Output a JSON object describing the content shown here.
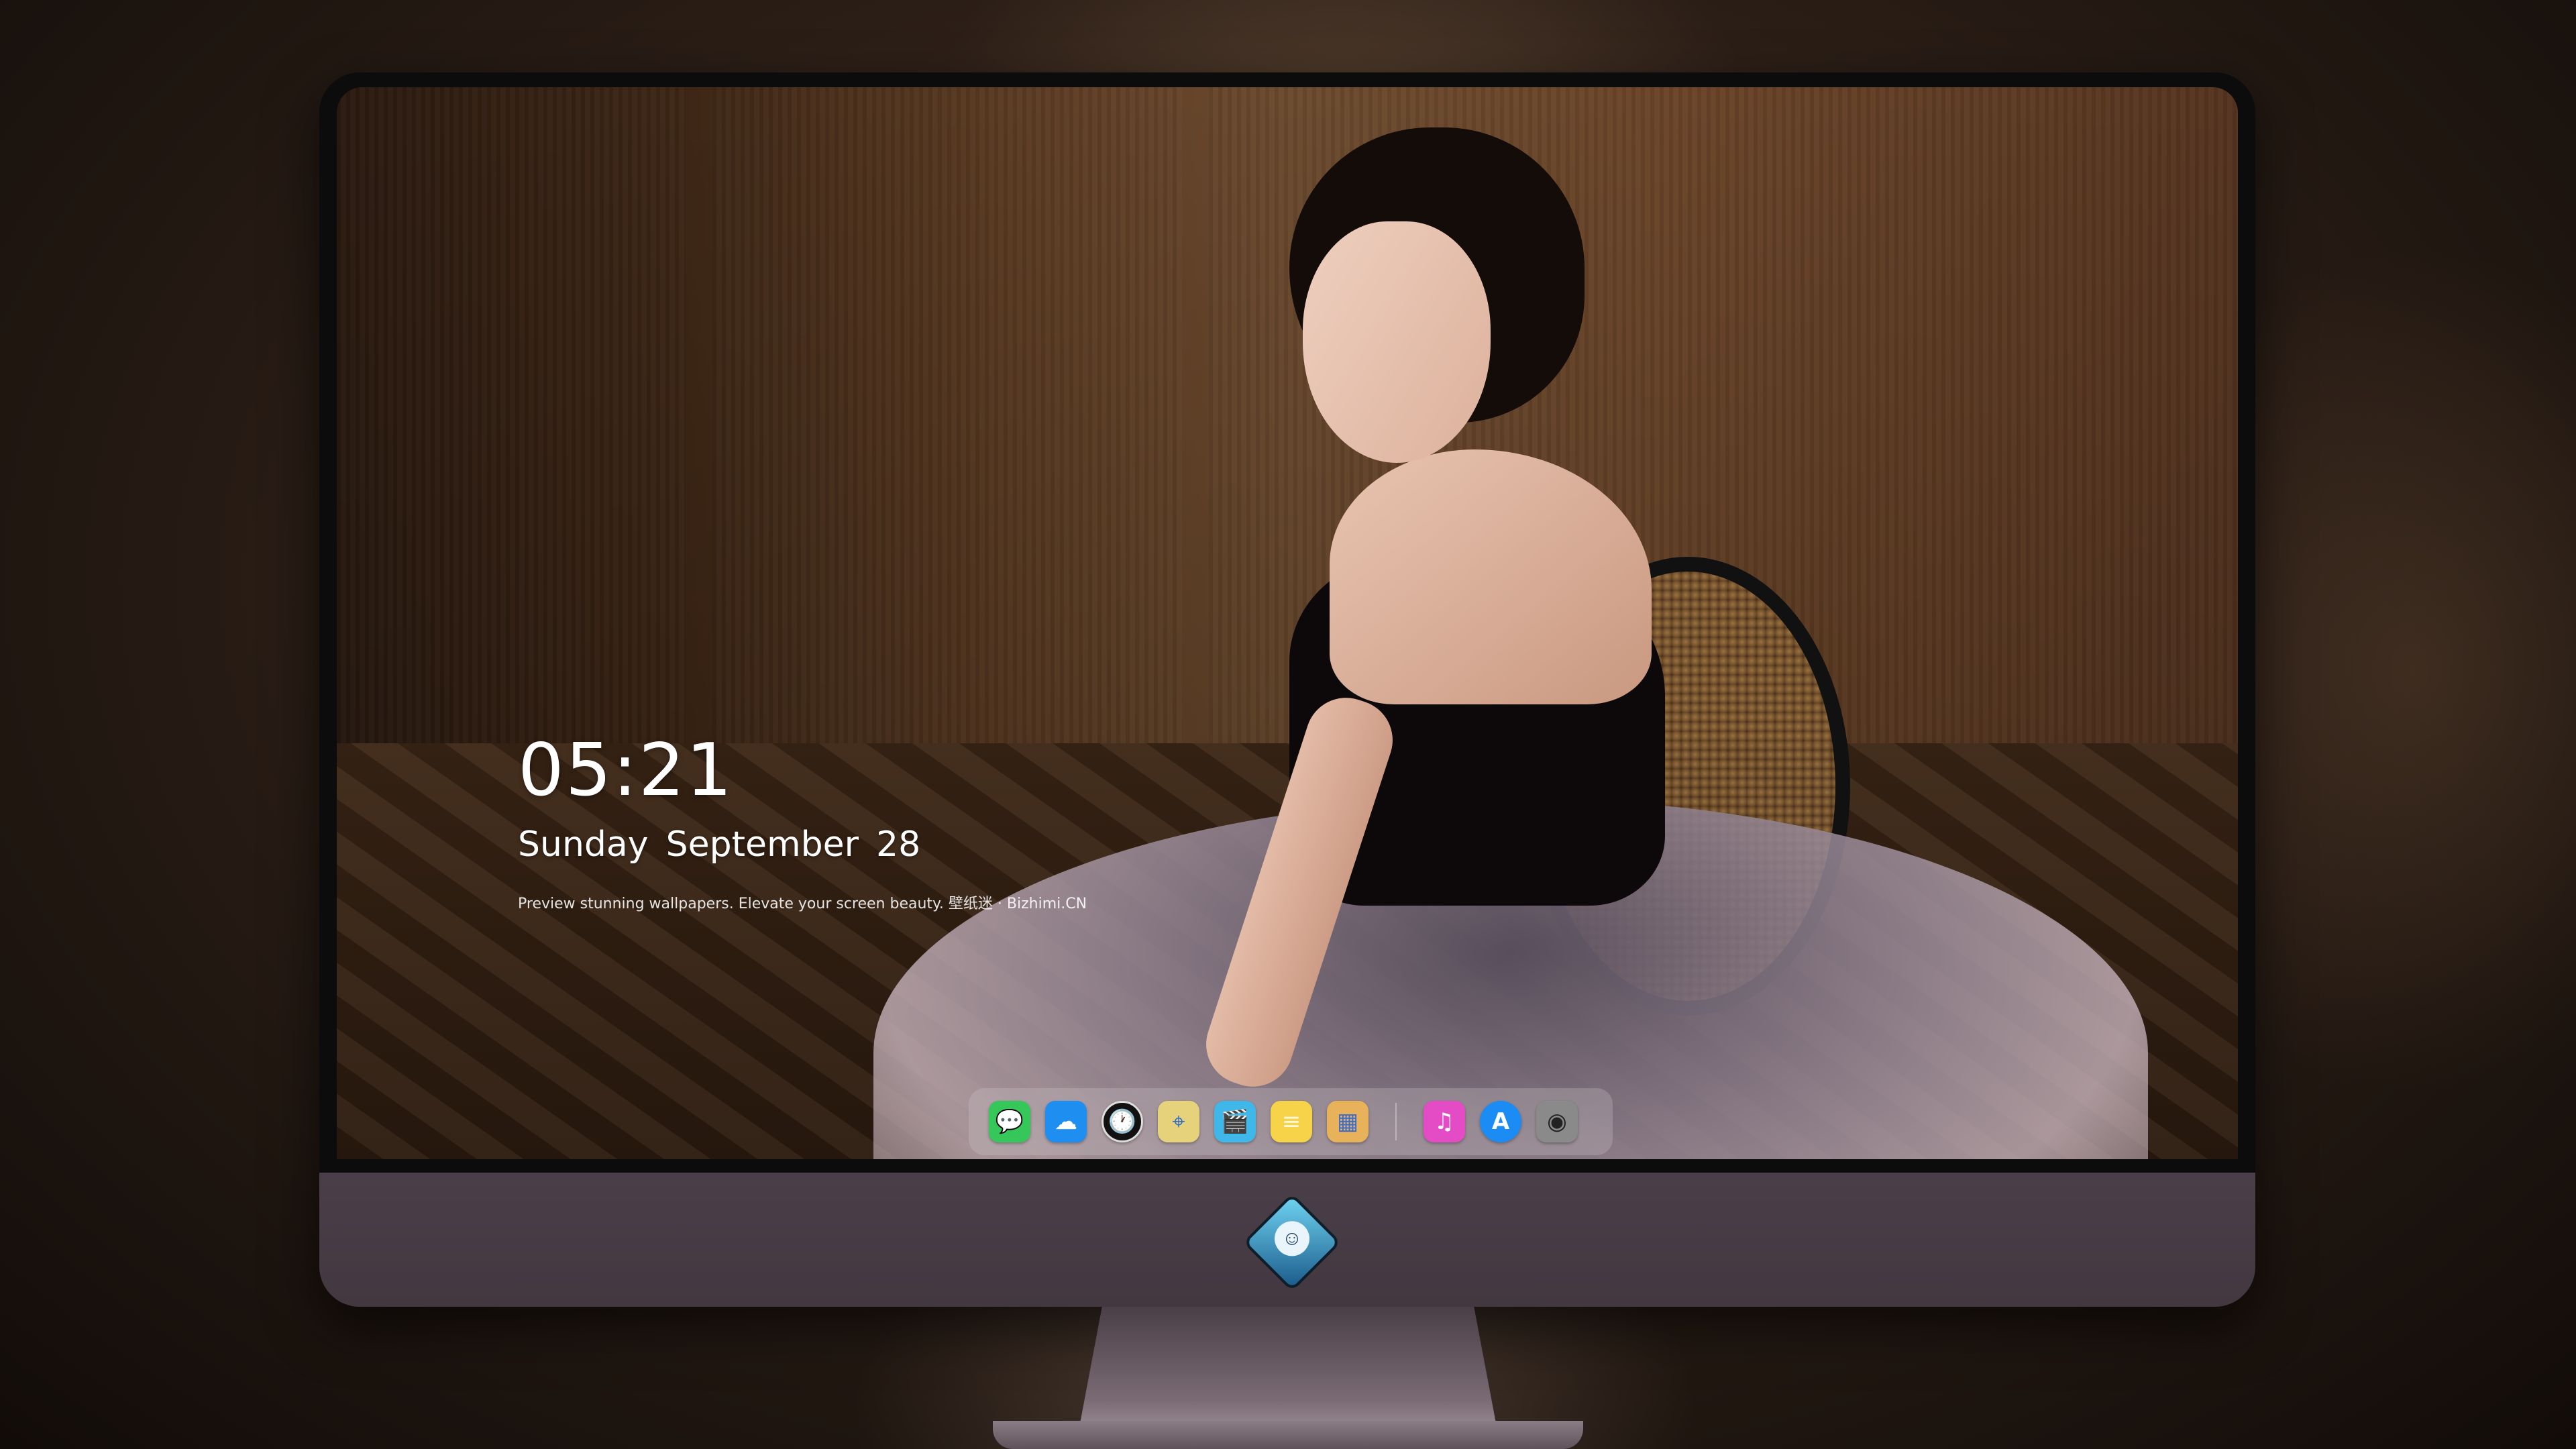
{
  "lock_screen": {
    "time": "05:21",
    "weekday": "Sunday",
    "month": "September",
    "day": "28",
    "tagline": "Preview stunning wallpapers. Elevate your screen beauty. 壁纸迷 · Bizhimi.CN"
  },
  "dock": {
    "apps": [
      {
        "name": "messages",
        "icon": "chat-bubble",
        "color": "#35c759",
        "glyph": "💬"
      },
      {
        "name": "weather",
        "icon": "cloud",
        "color": "#1e8ef0",
        "glyph": "☁"
      },
      {
        "name": "clock",
        "icon": "clock-face",
        "color": "#111111",
        "glyph": "🕐"
      },
      {
        "name": "maps",
        "icon": "map",
        "color": "#e6d27a",
        "glyph": "⌖"
      },
      {
        "name": "videos",
        "icon": "clapperboard",
        "color": "#3fb7e8",
        "glyph": "🎬"
      },
      {
        "name": "notes",
        "icon": "notepad",
        "color": "#f7d34a",
        "glyph": "≡"
      },
      {
        "name": "photo-board",
        "icon": "photo-grid",
        "color": "#e8b25a",
        "glyph": "▦"
      },
      {
        "name": "music",
        "icon": "music-note",
        "color": "#e44cc6",
        "glyph": "♫"
      },
      {
        "name": "app-store",
        "icon": "app-store",
        "color": "#1b8cf3",
        "glyph": "A"
      },
      {
        "name": "camera",
        "icon": "camera",
        "color": "#8a8a8a",
        "glyph": "◉"
      }
    ]
  },
  "colors": {
    "monitor_bezel": "#0c0c0c",
    "monitor_chin": "#463a43"
  }
}
